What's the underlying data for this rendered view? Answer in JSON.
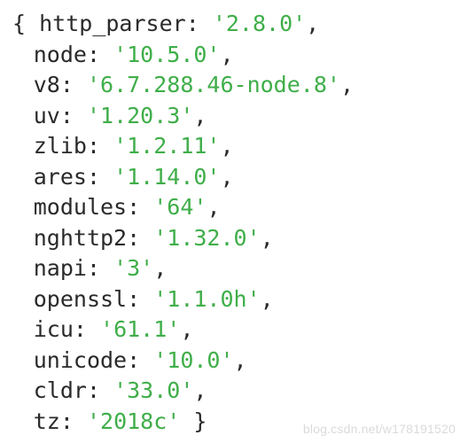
{
  "code": {
    "open_brace": "{",
    "close_brace": "}",
    "entries": [
      {
        "key": "http_parser",
        "value": "'2.8.0'"
      },
      {
        "key": "node",
        "value": "'10.5.0'"
      },
      {
        "key": "v8",
        "value": "'6.7.288.46-node.8'"
      },
      {
        "key": "uv",
        "value": "'1.20.3'"
      },
      {
        "key": "zlib",
        "value": "'1.2.11'"
      },
      {
        "key": "ares",
        "value": "'1.14.0'"
      },
      {
        "key": "modules",
        "value": "'64'"
      },
      {
        "key": "nghttp2",
        "value": "'1.32.0'"
      },
      {
        "key": "napi",
        "value": "'3'"
      },
      {
        "key": "openssl",
        "value": "'1.1.0h'"
      },
      {
        "key": "icu",
        "value": "'61.1'"
      },
      {
        "key": "unicode",
        "value": "'10.0'"
      },
      {
        "key": "cldr",
        "value": "'33.0'"
      },
      {
        "key": "tz",
        "value": "'2018c'"
      }
    ]
  },
  "watermark": "blog.csdn.net/w178191520"
}
